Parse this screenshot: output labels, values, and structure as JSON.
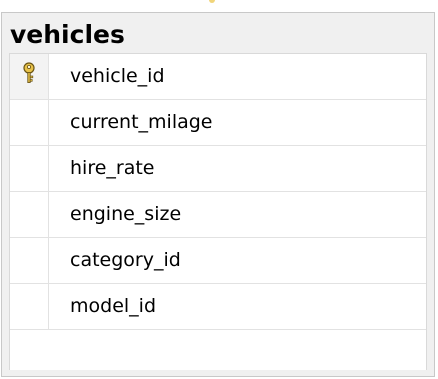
{
  "table": {
    "title": "vehicles",
    "columns": [
      {
        "name": "vehicle_id",
        "primary_key": true,
        "icon": "key-icon"
      },
      {
        "name": "current_milage",
        "primary_key": false
      },
      {
        "name": "hire_rate",
        "primary_key": false
      },
      {
        "name": "engine_size",
        "primary_key": false
      },
      {
        "name": "category_id",
        "primary_key": false
      },
      {
        "name": "model_id",
        "primary_key": false
      }
    ]
  },
  "colors": {
    "key_icon": "#d9b02d",
    "border": "#c8c8c8"
  }
}
